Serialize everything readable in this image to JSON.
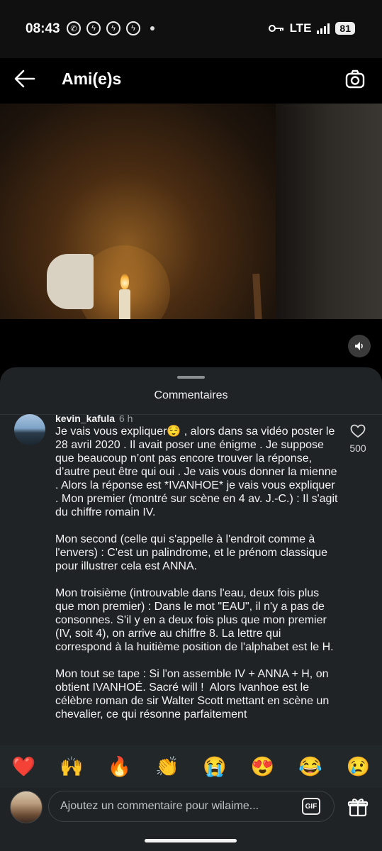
{
  "status_bar": {
    "time": "08:43",
    "network": "LTE",
    "battery": "81"
  },
  "header": {
    "title": "Ami(e)s"
  },
  "sheet": {
    "title": "Commentaires"
  },
  "comment": {
    "author": "kevin_kafula",
    "time": "6 h",
    "paragraphs": [
      "Je vais vous expliquer😌 , alors dans sa vidéo poster le 28 avril 2020 . Il avait poser une énigme . Je suppose que beaucoup n’ont pas encore trouver la réponse, d’autre peut être qui oui . Je vais vous donner la mienne . Alors la réponse est *IVANHOE* je vais vous expliquer . Mon premier (montré sur scène en 4 av. J.-C.) : Il s'agit du chiffre romain IV.",
      "Mon second (celle qui s'appelle à l'endroit comme à l'envers) : C'est un palindrome, et le prénom classique pour illustrer cela est ANNA.",
      "Mon troisième (introuvable dans l'eau, deux fois plus que mon premier) : Dans le mot \"EAU\", il n'y a pas de consonnes. S'il y en a deux fois plus que mon premier (IV, soit 4), on arrive au chiffre 8. La lettre qui correspond à la huitième position de l'alphabet est le H.",
      "Mon tout se tape : Si l'on assemble IV + ANNA + H, on obtient IVANHOÉ. Sacré will !  Alors Ivanhoe est le célèbre roman de sir Walter Scott mettant en scène un chevalier, ce qui résonne parfaitement"
    ],
    "likes": "500"
  },
  "emoji_bar": [
    "❤️",
    "🙌",
    "🔥",
    "👏",
    "😭",
    "😍",
    "😂",
    "😢"
  ],
  "input": {
    "placeholder": "Ajoutez un commentaire pour wilaime...",
    "gif_label": "GIF"
  }
}
